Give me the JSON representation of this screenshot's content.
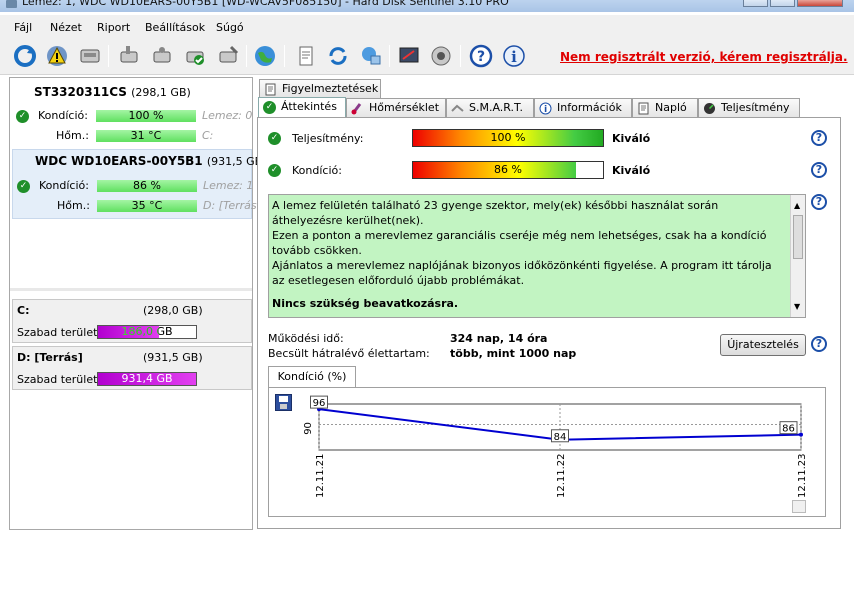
{
  "window": {
    "title": "Lemez: 1, WDC WD10EARS-00Y5B1 [WD-WCAV5F085150]  -  Hard Disk Sentinel 3.10 PRO"
  },
  "menu": [
    "Fájl",
    "Nézet",
    "Riport",
    "Beállítások",
    "Súgó"
  ],
  "toolbar": {
    "icons": [
      "refresh-icon",
      "warning-icon",
      "disk-icon",
      "disk-tool-icon",
      "disk-settings-icon",
      "disk-check-icon",
      "disk-wrench-icon",
      "globe-icon",
      "report-icon",
      "sync-icon",
      "network-icon",
      "dashboard-icon",
      "sound-icon",
      "help-icon",
      "info-icon"
    ],
    "unregistered": "Nem regisztrált verzió, kérem regisztrálja."
  },
  "disks": [
    {
      "name": "ST3320311CS",
      "size": "(298,1 GB)",
      "health_label": "Kondíció:",
      "health": "100 %",
      "health_extra": "Lemez: 0",
      "temp_label": "Hőm.:",
      "temp": "31 °C",
      "temp_extra": "C:"
    },
    {
      "name": "WDC WD10EARS-00Y5B1",
      "size": "(931,5 GB)",
      "health_label": "Kondíció:",
      "health": "86 %",
      "health_extra": "Lemez: 1",
      "temp_label": "Hőm.:",
      "temp": "35 °C",
      "temp_extra": "D: [Terrás"
    }
  ],
  "partitions": [
    {
      "name": "C:",
      "size": "(298,0 GB)",
      "free_label": "Szabad terület",
      "free": "186,0 GB",
      "free_fraction": 0.62
    },
    {
      "name": "D: [Terrás]",
      "size": "(931,5 GB)",
      "free_label": "Szabad terület",
      "free": "931,4 GB",
      "free_fraction": 1.0
    }
  ],
  "tabs_top": [
    "Figyelmeztetések"
  ],
  "tabs": [
    "Áttekintés",
    "Hőmérséklet",
    "S.M.A.R.T.",
    "Információk",
    "Napló",
    "Teljesítmény"
  ],
  "overview": {
    "performance_label": "Teljesítmény:",
    "performance_value": "100 %",
    "performance_fraction": 1.0,
    "performance_rating": "Kiváló",
    "health_label": "Kondíció:",
    "health_value": "86 %",
    "health_fraction": 0.86,
    "health_rating": "Kiváló",
    "message_lines": [
      "A lemez felületén található 23 gyenge szektor, mely(ek) későbbi használat során áthelyezésre kerülhet(nek).",
      "Ezen a ponton a merevlemez garanciális cseréje még nem lehetséges, csak ha a kondíció tovább csökken.",
      "Ajánlatos a merevlemez naplójának bizonyos időközönkénti figyelése. A program itt tárolja az esetlegesen előforduló újabb problémákat."
    ],
    "message_bold": "Nincs szükség beavatkozásra.",
    "uptime_label": "Működési idő:",
    "uptime_value": "324 nap, 14 óra",
    "remaining_label": "Becsült hátralévő élettartam:",
    "remaining_value": "több, mint 1000 nap",
    "retest_button": "Újratesztelés",
    "chart_tab": "Kondíció  (%)"
  },
  "chart_data": {
    "type": "line",
    "x": [
      "12.11.21",
      "12.11.22",
      "12.11.23"
    ],
    "values": [
      96,
      84,
      86
    ],
    "ytick": "90",
    "point_labels": [
      "96",
      "84",
      "86"
    ],
    "ylim": [
      80,
      98
    ],
    "grid": true,
    "color": "#0000d0"
  }
}
